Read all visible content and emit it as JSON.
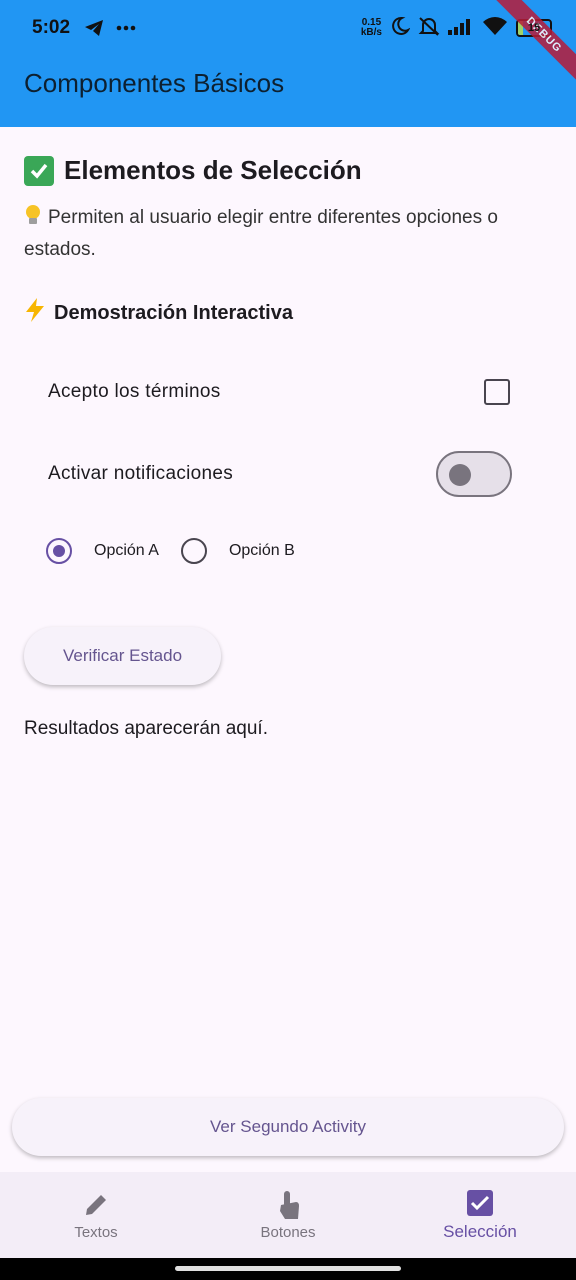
{
  "status_bar": {
    "time": "5:02",
    "net_speed_value": "0.15",
    "net_speed_unit": "kB/s",
    "battery": "15",
    "battery_level": 0.15,
    "icons": [
      "telegram-icon",
      "more-dots-icon",
      "moon-icon",
      "mute-icon",
      "signal-icon",
      "wifi-icon",
      "battery-icon"
    ]
  },
  "debug_banner": "DEBUG",
  "app_bar": {
    "title": "Componentes Básicos",
    "color": "#2196f3"
  },
  "section": {
    "title": "Elementos de Selección",
    "description": "Permiten al usuario elegir entre diferentes opciones o estados.",
    "demo_title": "Demostración Interactiva"
  },
  "controls": {
    "terms_label": "Acepto los términos",
    "terms_checked": false,
    "notifications_label": "Activar notificaciones",
    "notifications_on": false,
    "radio_options": [
      {
        "label": "Opción A",
        "selected": true
      },
      {
        "label": "Opción B",
        "selected": false
      }
    ]
  },
  "verify_button": "Verificar Estado",
  "results_text": "Resultados aparecerán aquí.",
  "second_activity_button": "Ver Segundo Activity",
  "bottom_nav": [
    {
      "label": "Textos",
      "icon": "pencil-icon",
      "active": false
    },
    {
      "label": "Botones",
      "icon": "touch-icon",
      "active": false
    },
    {
      "label": "Selección",
      "icon": "checkbox-icon",
      "active": true
    }
  ],
  "colors": {
    "accent": "#6750a4",
    "app_bar": "#2196f3",
    "background": "#fdf7fe"
  }
}
